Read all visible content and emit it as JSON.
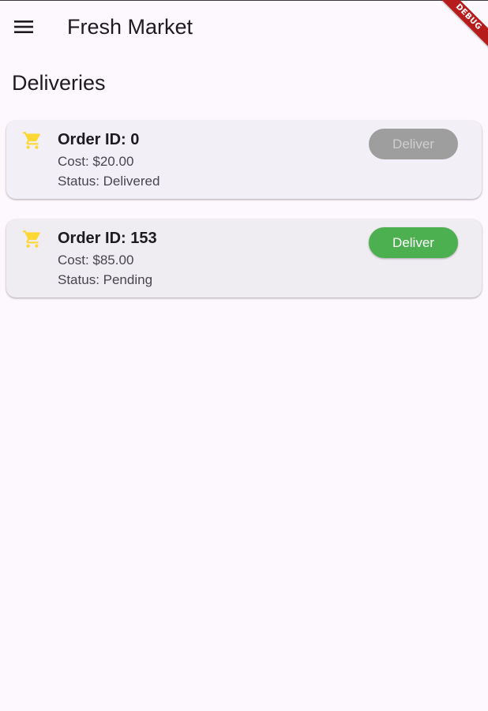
{
  "app_bar": {
    "title": "Fresh Market",
    "menu_icon": "menu-icon"
  },
  "debug_banner": {
    "label": "DEBUG",
    "color": "#b71c1c"
  },
  "page": {
    "section_title": "Deliveries"
  },
  "orders": [
    {
      "icon": "shopping-cart-icon",
      "id_label": "Order ID: 0",
      "cost_label": "Cost: $20.00",
      "status_label": "Status: Delivered",
      "button_label": "Deliver",
      "button_enabled": false
    },
    {
      "icon": "shopping-cart-icon",
      "id_label": "Order ID: 153",
      "cost_label": "Cost: $85.00",
      "status_label": "Status: Pending",
      "button_label": "Deliver",
      "button_enabled": true
    }
  ],
  "colors": {
    "background": "#fdf8fd",
    "card": "#f3eff6",
    "icon_accent": "#fdd835",
    "button_enabled": "#4caf50",
    "button_disabled": "#9e9e9e"
  }
}
